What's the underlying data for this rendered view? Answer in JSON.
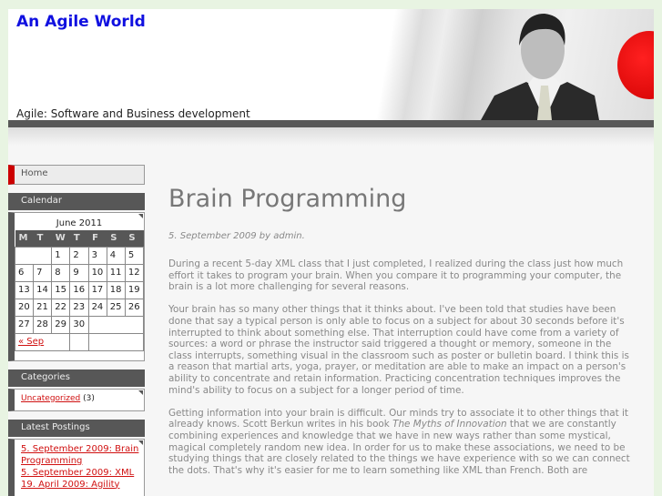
{
  "header": {
    "title": "An Agile World",
    "tagline": "Agile: Software and Business development"
  },
  "sidebar": {
    "home": "Home",
    "calendar": {
      "heading": "Calendar",
      "caption": "June 2011",
      "days": [
        "M",
        "T",
        "W",
        "T",
        "F",
        "S",
        "S"
      ],
      "weeks": [
        [
          "",
          "",
          "1",
          "2",
          "3",
          "4",
          "5"
        ],
        [
          "6",
          "7",
          "8",
          "9",
          "10",
          "11",
          "12"
        ],
        [
          "13",
          "14",
          "15",
          "16",
          "17",
          "18",
          "19"
        ],
        [
          "20",
          "21",
          "22",
          "23",
          "24",
          "25",
          "26"
        ],
        [
          "27",
          "28",
          "29",
          "30",
          "",
          "",
          ""
        ]
      ],
      "prev": "« Sep"
    },
    "categories": {
      "heading": "Categories",
      "items": [
        {
          "label": "Uncategorized",
          "count": "(3)"
        }
      ]
    },
    "latest": {
      "heading": "Latest Postings",
      "items": [
        "5. September 2009: Brain Programming",
        "5. September 2009: XML",
        "19. April 2009: Agility"
      ]
    }
  },
  "post": {
    "title": "Brain Programming",
    "meta": "5. September 2009 by admin.",
    "p1": "During a recent 5-day XML class that I just completed, I realized during the class just how much effort it takes to program your brain.  When you compare it to programming your computer, the brain is a lot more challenging for several reasons.",
    "p2": "Your brain has so many other things that it thinks about.  I've been told that studies have been done that say a typical person is only able to focus on a subject for about 30 seconds before it's interrupted to think about something else.  That interruption could have come from a variety of sources: a word or phrase the instructor said triggered a thought or memory, someone in the class interrupts, something visual in the classroom such as poster or bulletin board.  I think this is a reason that martial arts, yoga, prayer, or meditation are able to make an impact on a person's ability to concentrate and retain information.  Practicing concentration techniques improves the mind's ability to focus on a subject for a longer period of time.",
    "p3a": "Getting information into your brain is difficult.  Our minds try to associate it to other things that it already knows.  Scott Berkun writes in his book ",
    "p3book": "The Myths of Innovation",
    "p3b": " that we are constantly combining experiences and knowledge that we have in new ways rather than some mystical, magical completely random new idea.  In order for us to make these associations, we need to be studying things that are closely related to the things we have experience with so we can connect the dots.  That's why it's easier for me to learn something like XML than French.  Both are"
  }
}
